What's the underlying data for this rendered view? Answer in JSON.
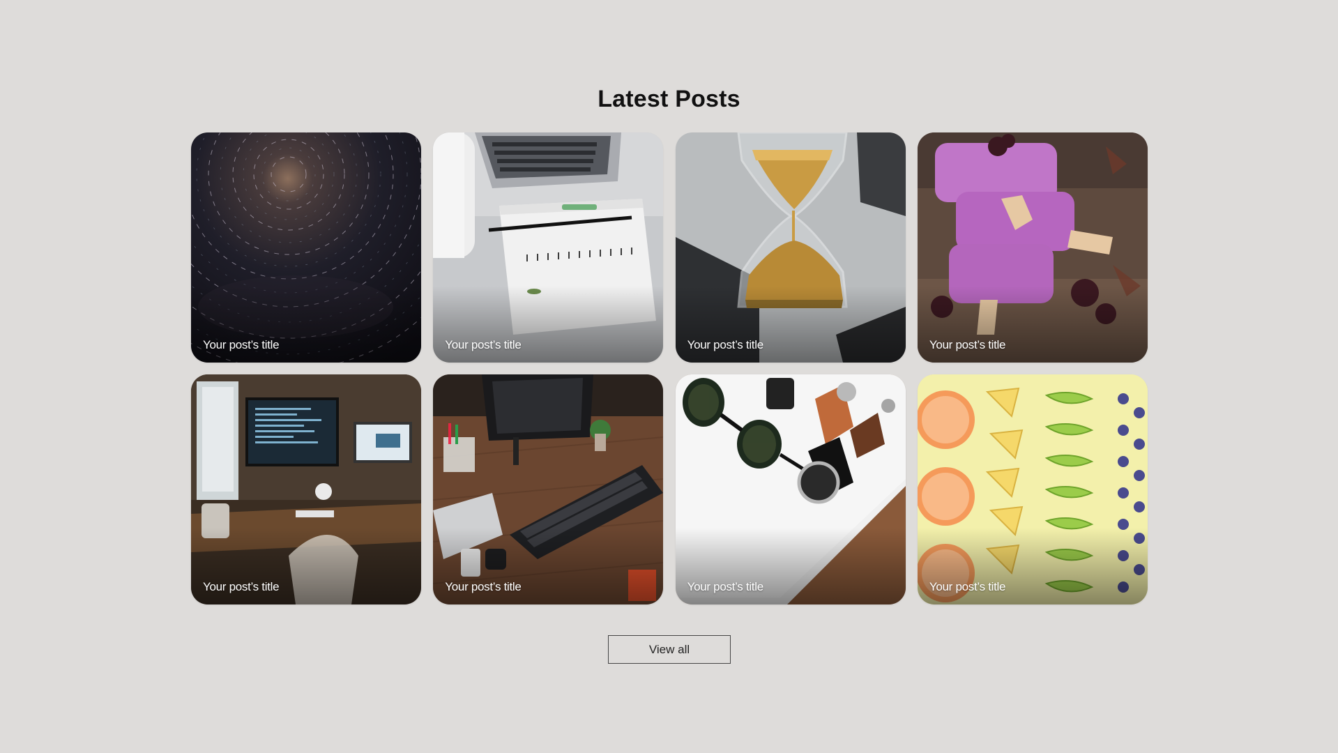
{
  "section": {
    "title": "Latest Posts",
    "view_all_label": "View all"
  },
  "posts": [
    {
      "title": "Your post’s title",
      "image": "star-trails-photo"
    },
    {
      "title": "Your post’s title",
      "image": "laptop-notebook-desk-photo"
    },
    {
      "title": "Your post’s title",
      "image": "hourglass-photo"
    },
    {
      "title": "Your post’s title",
      "image": "purple-popsicles-photo"
    },
    {
      "title": "Your post’s title",
      "image": "desk-setup-monitors-photo"
    },
    {
      "title": "Your post’s title",
      "image": "wooden-desk-keyboard-photo"
    },
    {
      "title": "Your post’s title",
      "image": "sunglasses-watches-photo"
    },
    {
      "title": "Your post’s title",
      "image": "fruit-slices-photo"
    }
  ],
  "colors": {
    "background": "#dedcda",
    "title_text": "#111111",
    "card_text": "#ffffff",
    "button_border": "#444444"
  }
}
